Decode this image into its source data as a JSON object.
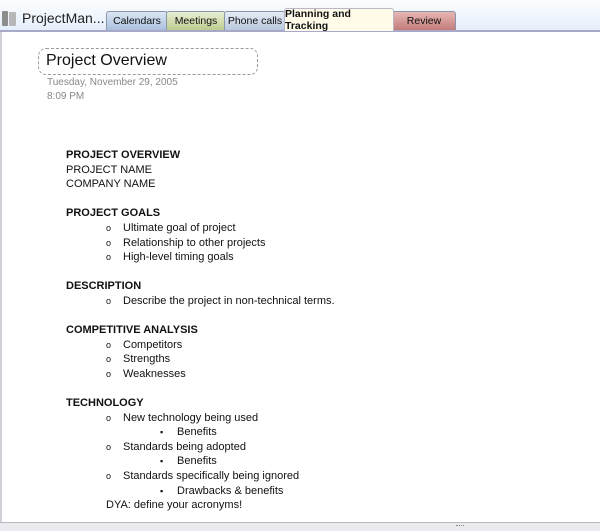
{
  "notebook": {
    "title": "ProjectMan...",
    "icon": "notebook-icon"
  },
  "tabs": [
    {
      "label": "Calendars",
      "color": "#a9c0dc"
    },
    {
      "label": "Meetings",
      "color": "#bccb8d"
    },
    {
      "label": "Phone calls",
      "color": "#b8c8dd"
    },
    {
      "label": "Planning and Tracking",
      "color": "#fffbe8",
      "active": true
    },
    {
      "label": "Review",
      "color": "#c27c7a"
    }
  ],
  "page": {
    "title": "Project Overview",
    "date": "Tuesday, November  29, 2005",
    "time": "8:09 PM"
  },
  "content": {
    "overview": {
      "heading": "PROJECT OVERVIEW",
      "lines": [
        "PROJECT NAME",
        "COMPANY NAME"
      ]
    },
    "goals": {
      "heading": "PROJECT GOALS",
      "items": [
        "Ultimate goal of project",
        "Relationship to other projects",
        "High-level timing goals"
      ]
    },
    "description": {
      "heading": "DESCRIPTION",
      "items": [
        "Describe the project in non-technical terms."
      ]
    },
    "competitive": {
      "heading": "COMPETITIVE ANALYSIS",
      "items": [
        "Competitors",
        "Strengths",
        "Weaknesses"
      ]
    },
    "technology": {
      "heading": "TECHNOLOGY",
      "items": [
        {
          "label": "New technology being used",
          "sub": "Benefits"
        },
        {
          "label": "Standards being adopted",
          "sub": "Benefits"
        },
        {
          "label": "Standards specifically being ignored",
          "sub": "Drawbacks & benefits"
        }
      ],
      "note": "DYA: define your acronyms!"
    },
    "bullet_level1": "o",
    "bullet_level2": "▪"
  }
}
